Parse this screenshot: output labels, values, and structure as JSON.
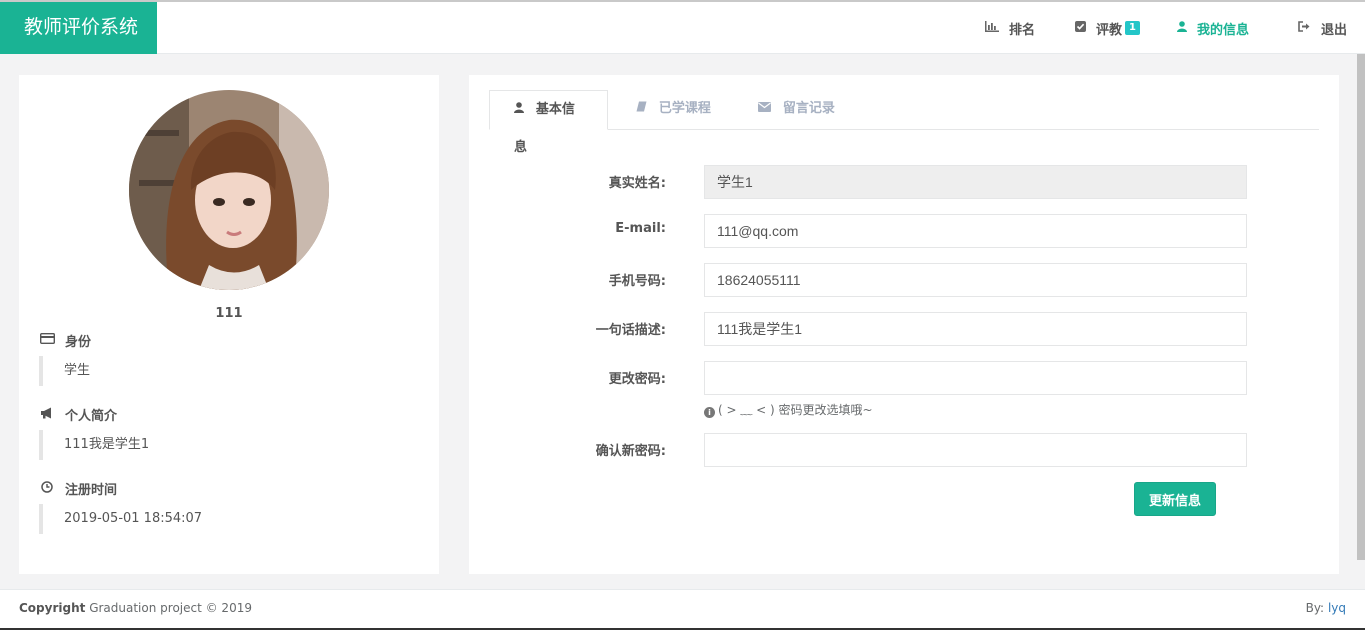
{
  "app": {
    "title": "教师评价系统"
  },
  "nav": {
    "rank": {
      "label": "排名",
      "icon": "bar-chart-icon"
    },
    "evaluate": {
      "label": "评教",
      "badge": "1",
      "icon": "check-square-icon"
    },
    "my_info": {
      "label": "我的信息",
      "icon": "user-icon"
    },
    "logout": {
      "label": "退出",
      "icon": "sign-out-icon"
    }
  },
  "profile": {
    "username": "111",
    "identity": {
      "heading": "身份",
      "value": "学生",
      "icon": "id-card-icon"
    },
    "bio": {
      "heading": "个人简介",
      "value": "111我是学生1",
      "icon": "megaphone-icon"
    },
    "registered": {
      "heading": "注册时间",
      "value": "2019-05-01 18:54:07",
      "icon": "clock-icon"
    }
  },
  "tabs": [
    {
      "label": "基本信息",
      "icon": "user-icon",
      "active": true
    },
    {
      "label": "已学课程",
      "icon": "book-icon",
      "active": false
    },
    {
      "label": "留言记录",
      "icon": "envelope-icon",
      "active": false
    }
  ],
  "form": {
    "real_name": {
      "label": "真实姓名:",
      "value": "学生1"
    },
    "email": {
      "label": "E-mail:",
      "value": "111@qq.com"
    },
    "phone": {
      "label": "手机号码:",
      "value": "18624055111"
    },
    "description": {
      "label": "一句话描述:",
      "value": "111我是学生1"
    },
    "new_password": {
      "label": "更改密码:",
      "value": ""
    },
    "password_hint": "( > ﹏ < ) 密码更改选填哦~",
    "confirm_password": {
      "label": "确认新密码:",
      "value": ""
    },
    "submit_label": "更新信息"
  },
  "footer": {
    "copyright_bold": "Copyright",
    "copyright_text": " Graduation project © 2019",
    "by_label": "By:",
    "by_link": "lyq"
  },
  "colors": {
    "accent": "#1ab394",
    "badge": "#23c6c8",
    "link": "#337ab7"
  }
}
